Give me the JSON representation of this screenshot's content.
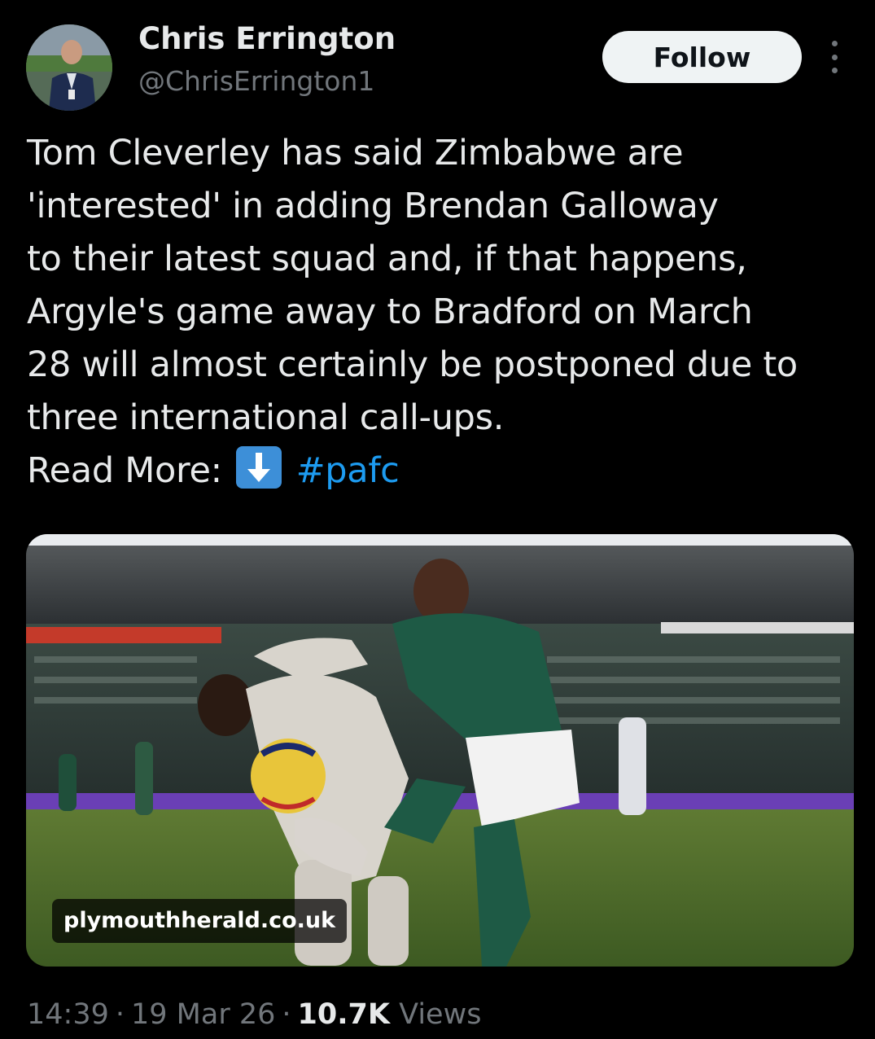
{
  "author": {
    "name": "Chris Errington",
    "handle": "@ChrisErrington1",
    "avatar_icon": "profile-photo"
  },
  "header": {
    "follow_label": "Follow",
    "more_icon": "more-vertical-icon"
  },
  "tweet": {
    "lines": [
      "Tom Cleverley has said Zimbabwe are",
      "'interested' in adding Brendan Galloway",
      "to their latest squad and, if that happens,",
      "Argyle's game away to  Bradford on March",
      "28 will almost certainly be postponed due to",
      "three international call-ups."
    ],
    "read_more_label": "Read More:",
    "emoji_icon": "down-arrow-emoji-icon",
    "hashtag": "#pafc"
  },
  "media": {
    "source_domain": "plymouthherald.co.uk"
  },
  "meta": {
    "time": "14:39",
    "separator": "·",
    "date": "19 Mar 26",
    "views_count": "10.7K",
    "views_label": "Views"
  },
  "colors": {
    "background": "#000000",
    "text_primary": "#e7e9ea",
    "text_secondary": "#71767b",
    "link": "#1d9bf0",
    "follow_button_bg": "#eff3f4"
  }
}
